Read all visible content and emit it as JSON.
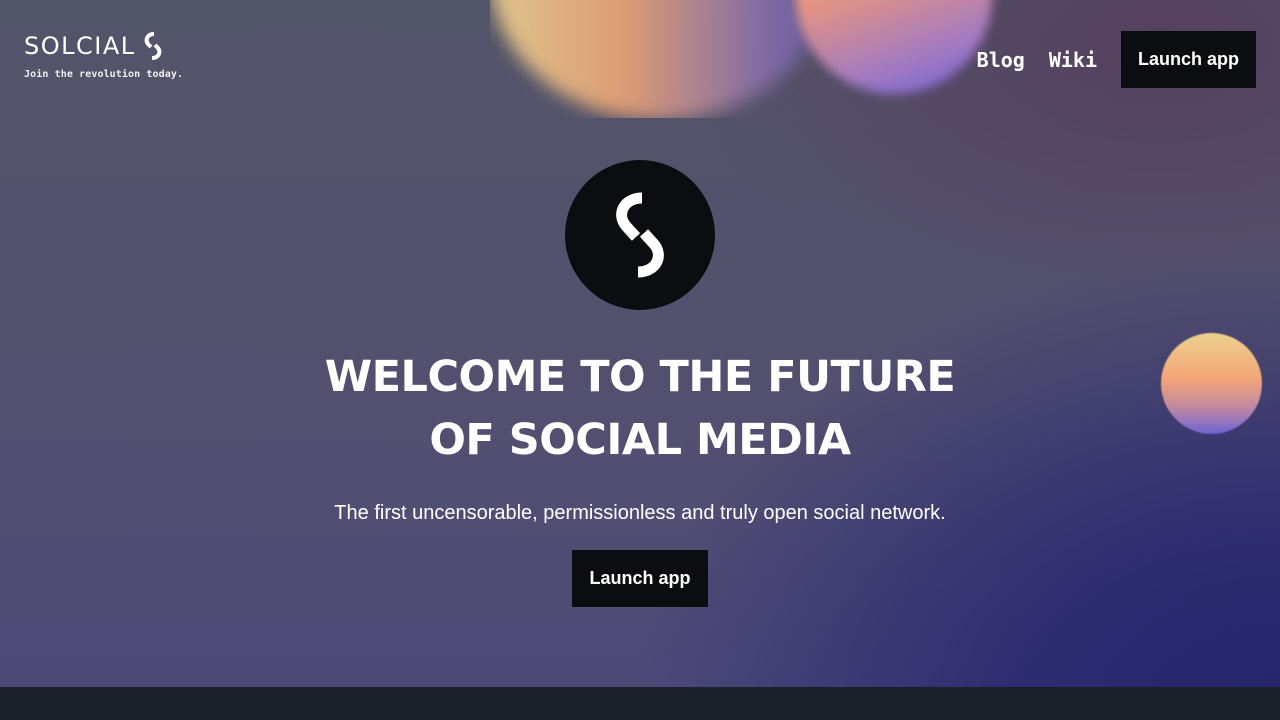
{
  "brand": {
    "name": "SOLCIAL",
    "tagline": "Join the revolution today."
  },
  "nav": {
    "links": [
      "Blog",
      "Wiki"
    ],
    "launch_label": "Launch app"
  },
  "hero": {
    "headline_line1": "WELCOME TO THE FUTURE",
    "headline_line2": "OF SOCIAL MEDIA",
    "subtitle": "The first uncensorable, permissionless and truly open social network.",
    "cta_label": "Launch app"
  },
  "colors": {
    "button_bg": "#0b0d10",
    "footer_bg": "#1b2029",
    "text": "#ffffff"
  }
}
